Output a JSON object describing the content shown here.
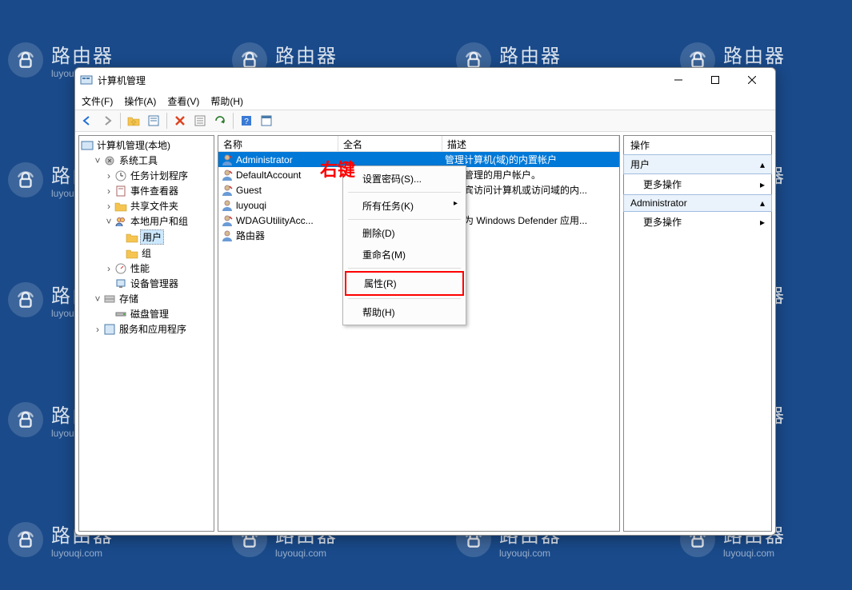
{
  "window": {
    "title": "计算机管理"
  },
  "menubar": {
    "file": "文件(F)",
    "action": "操作(A)",
    "view": "查看(V)",
    "help": "帮助(H)"
  },
  "tree": {
    "root": "计算机管理(本地)",
    "systools": "系统工具",
    "task": "任务计划程序",
    "event": "事件查看器",
    "shared": "共享文件夹",
    "localusers": "本地用户和组",
    "users": "用户",
    "groups": "组",
    "perf": "性能",
    "devmgr": "设备管理器",
    "storage": "存储",
    "disk": "磁盘管理",
    "services": "服务和应用程序"
  },
  "list": {
    "cols": {
      "name": "名称",
      "fullname": "全名",
      "desc": "描述"
    },
    "rows": [
      {
        "name": "Administrator",
        "full": "",
        "desc": "管理计算机(域)的内置帐户"
      },
      {
        "name": "DefaultAccount",
        "full": "",
        "desc": "系统管理的用户帐户。"
      },
      {
        "name": "Guest",
        "full": "",
        "desc": "供来宾访问计算机或访问域的内..."
      },
      {
        "name": "luyouqi",
        "full": "",
        "desc": ""
      },
      {
        "name": "WDAGUtilityAcc...",
        "full": "",
        "desc": "系统为 Windows Defender 应用..."
      },
      {
        "name": "路由器",
        "full": "",
        "desc": ""
      }
    ]
  },
  "ctx": {
    "setpwd": "设置密码(S)...",
    "alltasks": "所有任务(K)",
    "delete": "删除(D)",
    "rename": "重命名(M)",
    "props": "属性(R)",
    "help": "帮助(H)"
  },
  "actions": {
    "title": "操作",
    "sec1": "用户",
    "more": "更多操作",
    "sec2": "Administrator"
  },
  "annotation": {
    "rightclick": "右键"
  },
  "watermark": {
    "title": "路由器",
    "sub": "luyouqi.com"
  }
}
